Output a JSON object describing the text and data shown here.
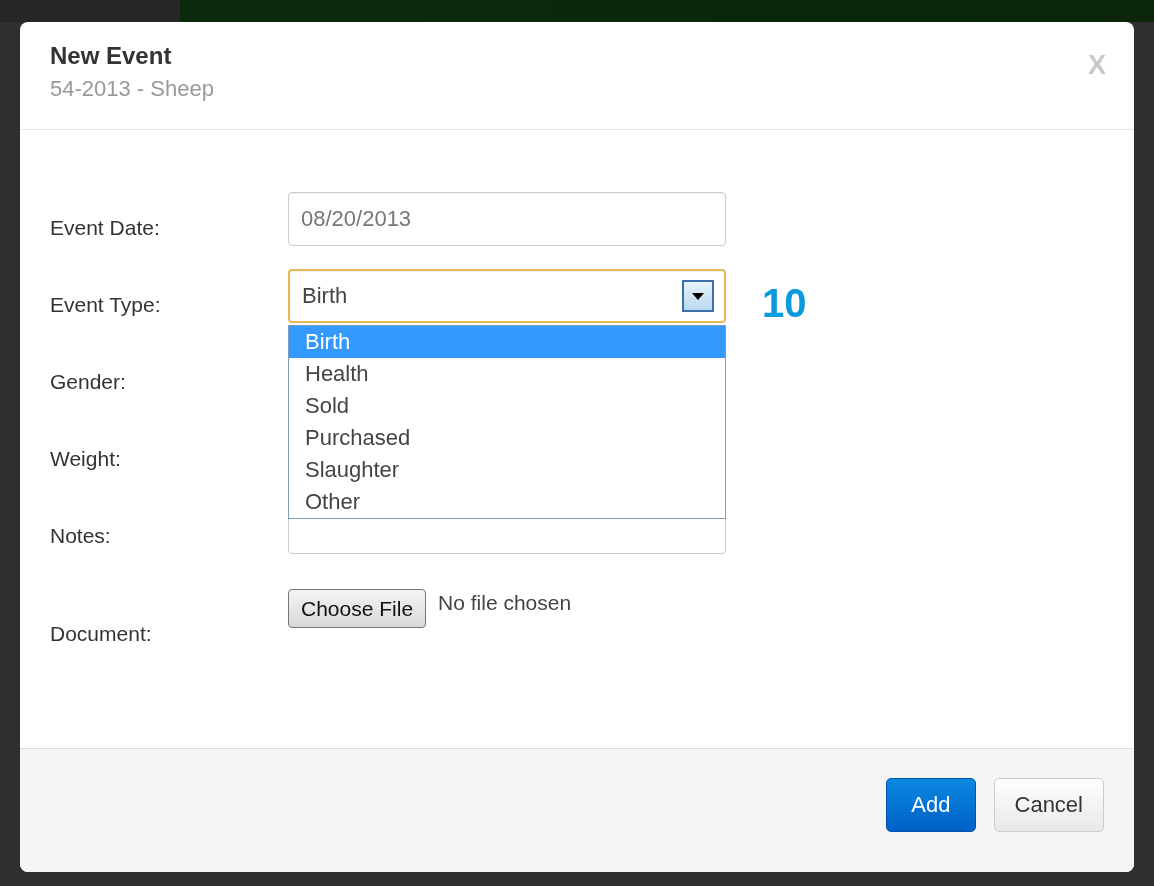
{
  "modal": {
    "title": "New Event",
    "subtitle": "54-2013 - Sheep",
    "close": "X"
  },
  "fields": [
    {
      "kind": "text",
      "label": "Event Date:",
      "value": "08/20/2013"
    },
    {
      "kind": "select",
      "label": "Event Type:",
      "value": "Birth",
      "focused": true,
      "expanded": true,
      "annotation": "10",
      "options": [
        {
          "label": "Birth",
          "selected": true
        },
        {
          "label": "Health",
          "selected": false
        },
        {
          "label": "Sold",
          "selected": false
        },
        {
          "label": "Purchased",
          "selected": false
        },
        {
          "label": "Slaughter",
          "selected": false
        },
        {
          "label": "Other",
          "selected": false
        }
      ]
    },
    {
      "kind": "covered",
      "label": "Gender:"
    },
    {
      "kind": "covered",
      "label": "Weight:"
    },
    {
      "kind": "text",
      "label": "Notes:"
    },
    {
      "kind": "file",
      "label": "Document:",
      "button": "Choose File",
      "status": "No file chosen"
    }
  ],
  "buttons": [
    {
      "label": "Add",
      "primary": true
    },
    {
      "label": "Cancel",
      "primary": false
    }
  ]
}
